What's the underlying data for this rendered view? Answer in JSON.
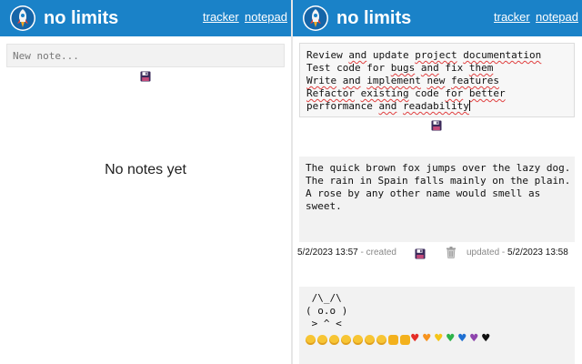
{
  "app": {
    "brand": "no limits",
    "nav": {
      "tracker": "tracker",
      "notepad": "notepad"
    },
    "colors": {
      "header": "#1a82c8",
      "note_bg": "#f2f2f2",
      "spell_underline": "#e04040"
    }
  },
  "left_pane": {
    "new_note": {
      "placeholder": "New note..."
    },
    "save_icon": "floppy-disk-icon",
    "empty_message": "No notes yet"
  },
  "right_pane": {
    "editing_note": {
      "lines": [
        "Review and update project documentation",
        "Test code for bugs and fix them",
        "Write and implement new features",
        "Refactor existing code for better",
        "performance and readability"
      ]
    },
    "note_2": {
      "lines": [
        "The quick brown fox jumps over the lazy dog.",
        "The rain in Spain falls mainly on the plain.",
        "A rose by any other name would smell as",
        "sweet."
      ],
      "created_date": "5/2/2023 13:57",
      "created_label": "- created",
      "updated_label": "updated -",
      "updated_date": "5/2/2023 13:58"
    },
    "note_3": {
      "lines": [
        " /\\_/\\",
        "( o.o )",
        " > ^ <"
      ],
      "emojis": [
        "smile",
        "grin",
        "grin",
        "grin",
        "grin",
        "sweat-smile",
        "rofl",
        "thumbs-up",
        "thumbs-down",
        "red-heart",
        "orange-heart",
        "yellow-heart",
        "green-heart",
        "blue-heart",
        "purple-heart",
        "black-heart"
      ]
    }
  }
}
